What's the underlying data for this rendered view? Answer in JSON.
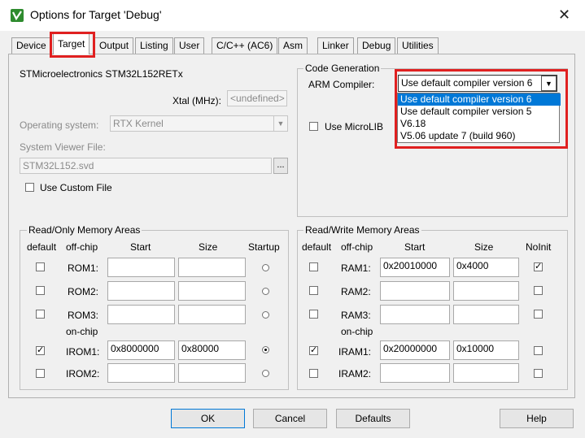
{
  "window": {
    "title": "Options for Target 'Debug'",
    "close_glyph": "✕",
    "icon": "uvision-icon"
  },
  "tabs": [
    {
      "label": "Device"
    },
    {
      "label": "Target"
    },
    {
      "label": "Output"
    },
    {
      "label": "Listing"
    },
    {
      "label": "User"
    },
    {
      "label": "C/C++ (AC6)"
    },
    {
      "label": "Asm"
    },
    {
      "label": "Linker"
    },
    {
      "label": "Debug"
    },
    {
      "label": "Utilities"
    }
  ],
  "active_tab": "Target",
  "target": {
    "device_name": "STMicroelectronics STM32L152RETx",
    "xtal_label": "Xtal (MHz):",
    "xtal_value": "<undefined>",
    "os_label": "Operating system:",
    "os_value": "RTX Kernel",
    "svf_label": "System Viewer File:",
    "svf_value": "STM32L152.svd",
    "browse_label": "...",
    "use_custom_file": "Use Custom File"
  },
  "code_generation": {
    "group_title": "Code Generation",
    "arm_compiler_label": "ARM Compiler:",
    "compiler_value": "Use default compiler version 6",
    "use_microlib": "Use MicroLIB",
    "dropdown_options": [
      "Use default compiler version 6",
      "Use default compiler version 5",
      "V6.18",
      "V5.06 update 7 (build 960)"
    ],
    "selected_option": 0
  },
  "ro_memory": {
    "group_title": "Read/Only Memory Areas",
    "headers": {
      "default": "default",
      "offchip": "off-chip",
      "start": "Start",
      "size": "Size",
      "startup": "Startup"
    },
    "onchip_label": "on-chip",
    "rows": [
      {
        "name": "ROM1:",
        "start": "",
        "size": "",
        "default": false,
        "startup": false
      },
      {
        "name": "ROM2:",
        "start": "",
        "size": "",
        "default": false,
        "startup": false
      },
      {
        "name": "ROM3:",
        "start": "",
        "size": "",
        "default": false,
        "startup": false
      },
      {
        "name": "IROM1:",
        "start": "0x8000000",
        "size": "0x80000",
        "default": true,
        "startup": true
      },
      {
        "name": "IROM2:",
        "start": "",
        "size": "",
        "default": false,
        "startup": false
      }
    ]
  },
  "rw_memory": {
    "group_title": "Read/Write Memory Areas",
    "headers": {
      "default": "default",
      "offchip": "off-chip",
      "start": "Start",
      "size": "Size",
      "noinit": "NoInit"
    },
    "onchip_label": "on-chip",
    "rows": [
      {
        "name": "RAM1:",
        "start": "0x20010000",
        "size": "0x4000",
        "default": false,
        "noinit": true
      },
      {
        "name": "RAM2:",
        "start": "",
        "size": "",
        "default": false,
        "noinit": false
      },
      {
        "name": "RAM3:",
        "start": "",
        "size": "",
        "default": false,
        "noinit": false
      },
      {
        "name": "IRAM1:",
        "start": "0x20000000",
        "size": "0x10000",
        "default": true,
        "noinit": false
      },
      {
        "name": "IRAM2:",
        "start": "",
        "size": "",
        "default": false,
        "noinit": false
      }
    ]
  },
  "buttons": {
    "ok": "OK",
    "cancel": "Cancel",
    "defaults": "Defaults",
    "help": "Help"
  },
  "check_glyph": "✓",
  "dropdown_glyph": "▼",
  "colors": {
    "highlight": "#e02020",
    "selection": "#0078d7",
    "dialog_bg": "#f0f0f0"
  }
}
